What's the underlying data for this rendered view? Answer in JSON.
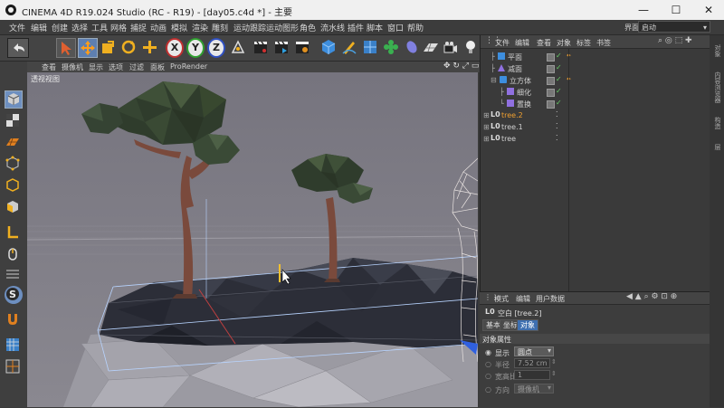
{
  "window": {
    "title": "CINEMA 4D R19.024 Studio (RC - R19) - [day05.c4d *] - 主要",
    "minimize": "—",
    "maximize": "☐",
    "close": "✕"
  },
  "menubar": {
    "items": [
      "文件",
      "编辑",
      "创建",
      "选择",
      "工具",
      "网格",
      "捕捉",
      "动画",
      "模拟",
      "渲染",
      "雕刻",
      "运动跟踪",
      "运动图形",
      "角色",
      "流水线",
      "插件",
      "脚本",
      "窗口",
      "帮助"
    ],
    "layout_label": "界面:",
    "layout_value": "启动"
  },
  "toolbar": {
    "axis_labels": [
      "X",
      "Y",
      "Z"
    ]
  },
  "viewport": {
    "menu": [
      "查看",
      "摄像机",
      "显示",
      "选项",
      "过滤",
      "面板",
      "ProRender"
    ],
    "label": "透视视图"
  },
  "object_manager": {
    "menu": [
      "文件",
      "编辑",
      "查看",
      "对象",
      "标签",
      "书签"
    ],
    "objects": [
      {
        "name": "平面",
        "indent": 1
      },
      {
        "name": "减面",
        "indent": 1
      },
      {
        "name": "立方体",
        "indent": 1
      },
      {
        "name": "细化",
        "indent": 2
      },
      {
        "name": "置换",
        "indent": 2
      },
      {
        "name": "tree.2",
        "indent": 0
      },
      {
        "name": "tree.1",
        "indent": 0
      },
      {
        "name": "tree",
        "indent": 0
      }
    ]
  },
  "attributes": {
    "menu": [
      "模式",
      "编辑",
      "用户数据"
    ],
    "object_title": "空白 [tree.2]",
    "tabs": [
      "基本",
      "坐标",
      "对象"
    ],
    "active_tab": "对象",
    "section": "对象属性",
    "fields": {
      "display_label": "显示",
      "display_value": "圆点",
      "radius_label": "半径",
      "radius_value": "7.52 cm",
      "aspect_label": "宽高比",
      "aspect_value": "1",
      "orient_label": "方向",
      "orient_value": "摄像机"
    }
  },
  "sidetabs": [
    "对象",
    "内容浏览器",
    "构造",
    "层"
  ]
}
